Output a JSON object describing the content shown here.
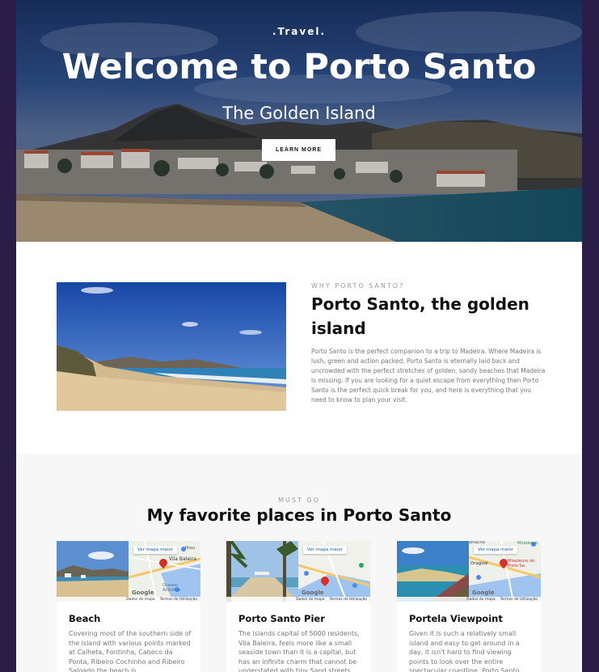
{
  "hero": {
    "tag": ".Travel.",
    "title": "Welcome to Porto Santo",
    "subtitle": "The Golden Island",
    "button_label": "LEARN MORE"
  },
  "why": {
    "eyebrow": "WHY PORTO SANTO?",
    "title": "Porto Santo, the golden island",
    "body": "Porto Santo is the perfect companion to a trip to Madeira. Where Madeira is lush, green and action packed, Porto Santo is eternally laid back and uncrowded with the perfect stretches of golden, sandy beaches that Madeira is missing. If you are looking for a quiet escape from everything then Porto Santo is the perfect quick break for you, and here is everything that you need to know to plan your visit."
  },
  "places": {
    "eyebrow": "MUST GO",
    "title": "My favorite places in Porto Santo",
    "map_button": "Ver mapa maior",
    "map_credit_data": "Dados do mapa",
    "map_credit_terms": "Termos de Utilização",
    "map_google": "Google",
    "cards": [
      {
        "title": "Beach",
        "body": "Covering most of the southern side of the island with various points marked at Calheta, Fontinha, Cabeco da Ponta, Ribeiro Cochinho and Ribeiro Salgado the beach is",
        "map_labels": [
          "Vila Baleira",
          "Oceano Atlântico",
          "Ilheu"
        ]
      },
      {
        "title": "Porto Santo Pier",
        "body": "The islands capital of 5000 residents, Vila Baleira, feels more like a small seaside town than it is a capital, but has an infinite charm that cannot be understated with tiny Sand streets",
        "map_labels": []
      },
      {
        "title": "Portela Viewpoint",
        "body": "Given it is such a relatively small island and easy to get around in a day, it isn't hard to find viewing points to look over the entire spectacular coastline. Porto Santo",
        "map_labels": [
          "amacha",
          "Miradouro",
          "Dragoal",
          "Miradouro do Porto Sa"
        ]
      }
    ]
  },
  "colors": {
    "page_background": "#2a1d47",
    "map_pin": "#d93025",
    "map_water": "#9fc4f0",
    "map_road": "#f6c86a"
  }
}
